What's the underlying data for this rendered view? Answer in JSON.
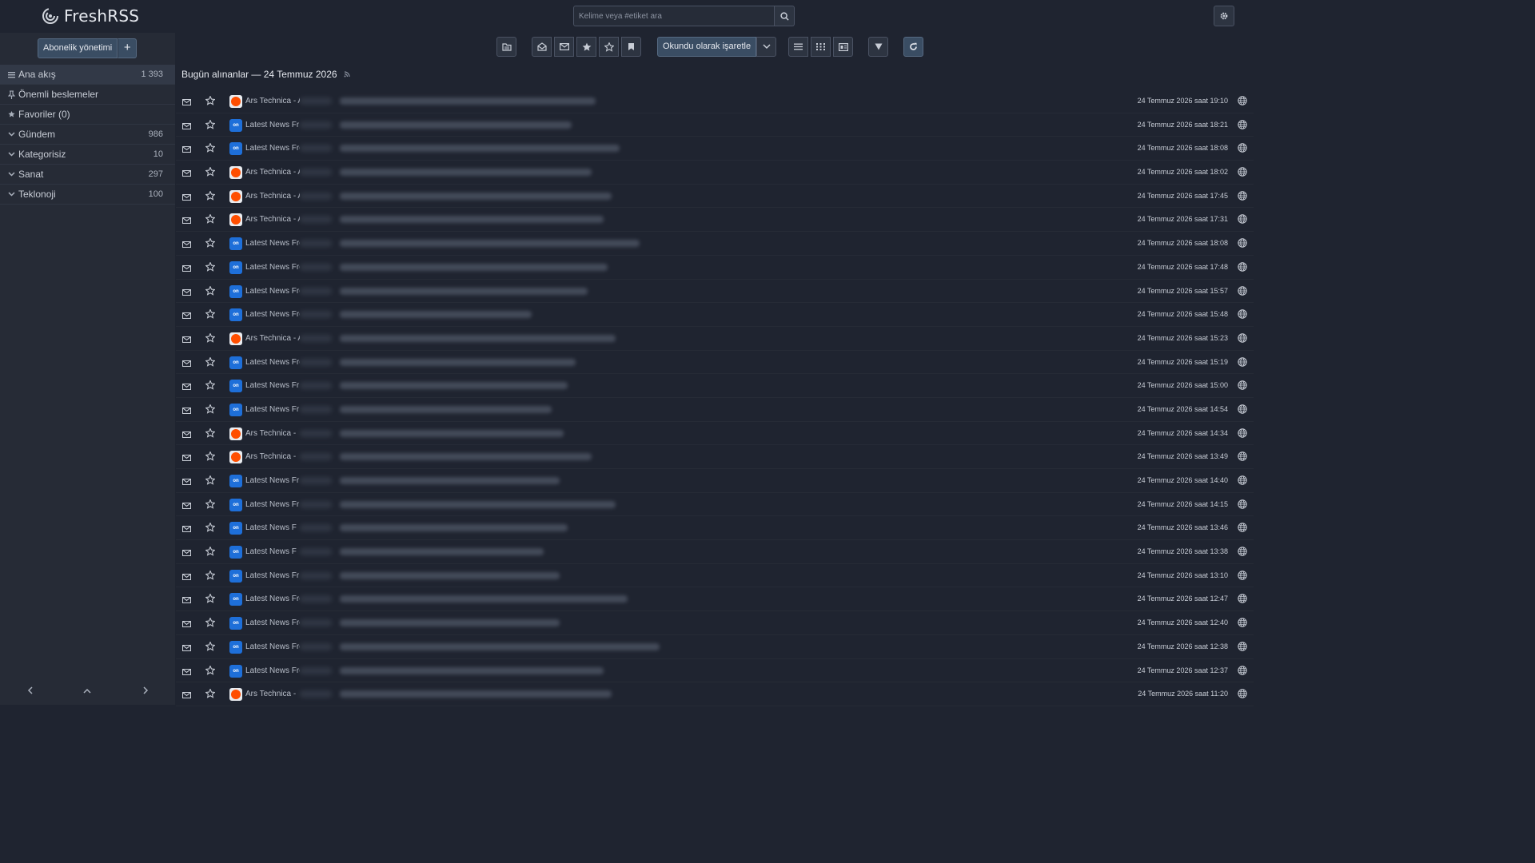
{
  "app": {
    "name": "FreshRSS"
  },
  "search": {
    "placeholder": "Kelime veya #etiket ara"
  },
  "sidebar": {
    "subscription_label": "Abonelik yönetimi",
    "add_label": "+",
    "items": [
      {
        "label": "Ana akış",
        "count": "1 393",
        "icon": "list-icon",
        "active": true
      },
      {
        "label": "Önemli beslemeler",
        "count": "",
        "icon": "pin-icon"
      },
      {
        "label": "Favoriler (0)",
        "count": "",
        "icon": "star-icon"
      },
      {
        "label": "Gündem",
        "count": "986",
        "icon": "chevron-down-icon"
      },
      {
        "label": "Kategorisiz",
        "count": "10",
        "icon": "chevron-down-icon"
      },
      {
        "label": "Sanat",
        "count": "297",
        "icon": "chevron-down-icon"
      },
      {
        "label": "Teklonoji",
        "count": "100",
        "icon": "chevron-down-icon"
      }
    ]
  },
  "toolbar": {
    "mark_read_label": "Okundu olarak işaretle"
  },
  "page": {
    "title": "Bugün alınanlar — 24 Temmuz 2026"
  },
  "articles": [
    {
      "feed": "Ars Technica - A",
      "type": "ars",
      "date": "24 Temmuz 2026 saat 19:10"
    },
    {
      "feed": "Latest News Fr",
      "type": "news",
      "date": "24 Temmuz 2026 saat 18:21"
    },
    {
      "feed": "Latest News Fro",
      "type": "news",
      "date": "24 Temmuz 2026 saat 18:08"
    },
    {
      "feed": "Ars Technica - A",
      "type": "ars",
      "date": "24 Temmuz 2026 saat 18:02"
    },
    {
      "feed": "Ars Technica - A",
      "type": "ars",
      "date": "24 Temmuz 2026 saat 17:45"
    },
    {
      "feed": "Ars Technica - A",
      "type": "ars",
      "date": "24 Temmuz 2026 saat 17:31"
    },
    {
      "feed": "Latest News Fro",
      "type": "news",
      "date": "24 Temmuz 2026 saat 18:08"
    },
    {
      "feed": "Latest News Fror",
      "type": "news",
      "date": "24 Temmuz 2026 saat 17:48"
    },
    {
      "feed": "Latest News Fror",
      "type": "news",
      "date": "24 Temmuz 2026 saat 15:57"
    },
    {
      "feed": "Latest News Fro",
      "type": "news",
      "date": "24 Temmuz 2026 saat 15:48"
    },
    {
      "feed": "Ars Technica - A",
      "type": "ars",
      "date": "24 Temmuz 2026 saat 15:23"
    },
    {
      "feed": "Latest News Fro",
      "type": "news",
      "date": "24 Temmuz 2026 saat 15:19"
    },
    {
      "feed": "Latest News Fr",
      "type": "news",
      "date": "24 Temmuz 2026 saat 15:00"
    },
    {
      "feed": "Latest News Fr",
      "type": "news",
      "date": "24 Temmuz 2026 saat 14:54"
    },
    {
      "feed": "Ars Technica - ",
      "type": "ars",
      "date": "24 Temmuz 2026 saat 14:34"
    },
    {
      "feed": "Ars Technica - ",
      "type": "ars",
      "date": "24 Temmuz 2026 saat 13:49"
    },
    {
      "feed": "Latest News Fr",
      "type": "news",
      "date": "24 Temmuz 2026 saat 14:40"
    },
    {
      "feed": "Latest News Fr",
      "type": "news",
      "date": "24 Temmuz 2026 saat 14:15"
    },
    {
      "feed": "Latest News F",
      "type": "news",
      "date": "24 Temmuz 2026 saat 13:46"
    },
    {
      "feed": "Latest News F",
      "type": "news",
      "date": "24 Temmuz 2026 saat 13:38"
    },
    {
      "feed": "Latest News Fr",
      "type": "news",
      "date": "24 Temmuz 2026 saat 13:10"
    },
    {
      "feed": "Latest News Fro",
      "type": "news",
      "date": "24 Temmuz 2026 saat 12:47"
    },
    {
      "feed": "Latest News Fro",
      "type": "news",
      "date": "24 Temmuz 2026 saat 12:40"
    },
    {
      "feed": "Latest News Fro",
      "type": "news",
      "date": "24 Temmuz 2026 saat 12:38"
    },
    {
      "feed": "Latest News Fro",
      "type": "news",
      "date": "24 Temmuz 2026 saat 12:37"
    },
    {
      "feed": "Ars Technica - ",
      "type": "ars",
      "date": "24 Temmuz 2026 saat 11:20"
    }
  ]
}
